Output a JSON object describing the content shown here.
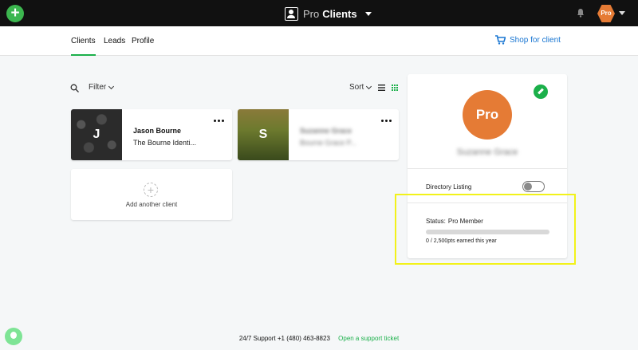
{
  "header": {
    "title_prefix": "Pro",
    "title_main": "Clients",
    "avatar_text": "Pro"
  },
  "subnav": {
    "tabs": [
      {
        "label": "Clients",
        "active": true
      },
      {
        "label": "Leads",
        "active": false
      },
      {
        "label": "Profile",
        "active": false
      }
    ],
    "shop_label": "Shop for client"
  },
  "toolbar": {
    "filter_label": "Filter",
    "sort_label": "Sort"
  },
  "clients": [
    {
      "initial": "J",
      "name": "Jason Bourne",
      "subtitle": "The Bourne Identi..."
    },
    {
      "initial": "S",
      "name": "Suzanne Grace",
      "subtitle": "Bourne Grace P..."
    }
  ],
  "add_client_label": "Add another client",
  "profile": {
    "avatar_text": "Pro",
    "name": "Suzanne Grace",
    "directory_label": "Directory Listing",
    "directory_enabled": false,
    "status_label": "Status:",
    "status_value": "Pro Member",
    "progress_fraction": 0,
    "points_text": "0 / 2,500pts earned this year"
  },
  "footer": {
    "support_text": "24/7 Support +1 (480) 463-8823",
    "ticket_link": "Open a support ticket"
  },
  "colors": {
    "accent_green": "#1bb04a",
    "brand_orange": "#e57b35",
    "link_blue": "#1976d2",
    "highlight_yellow": "#f2f21a"
  }
}
